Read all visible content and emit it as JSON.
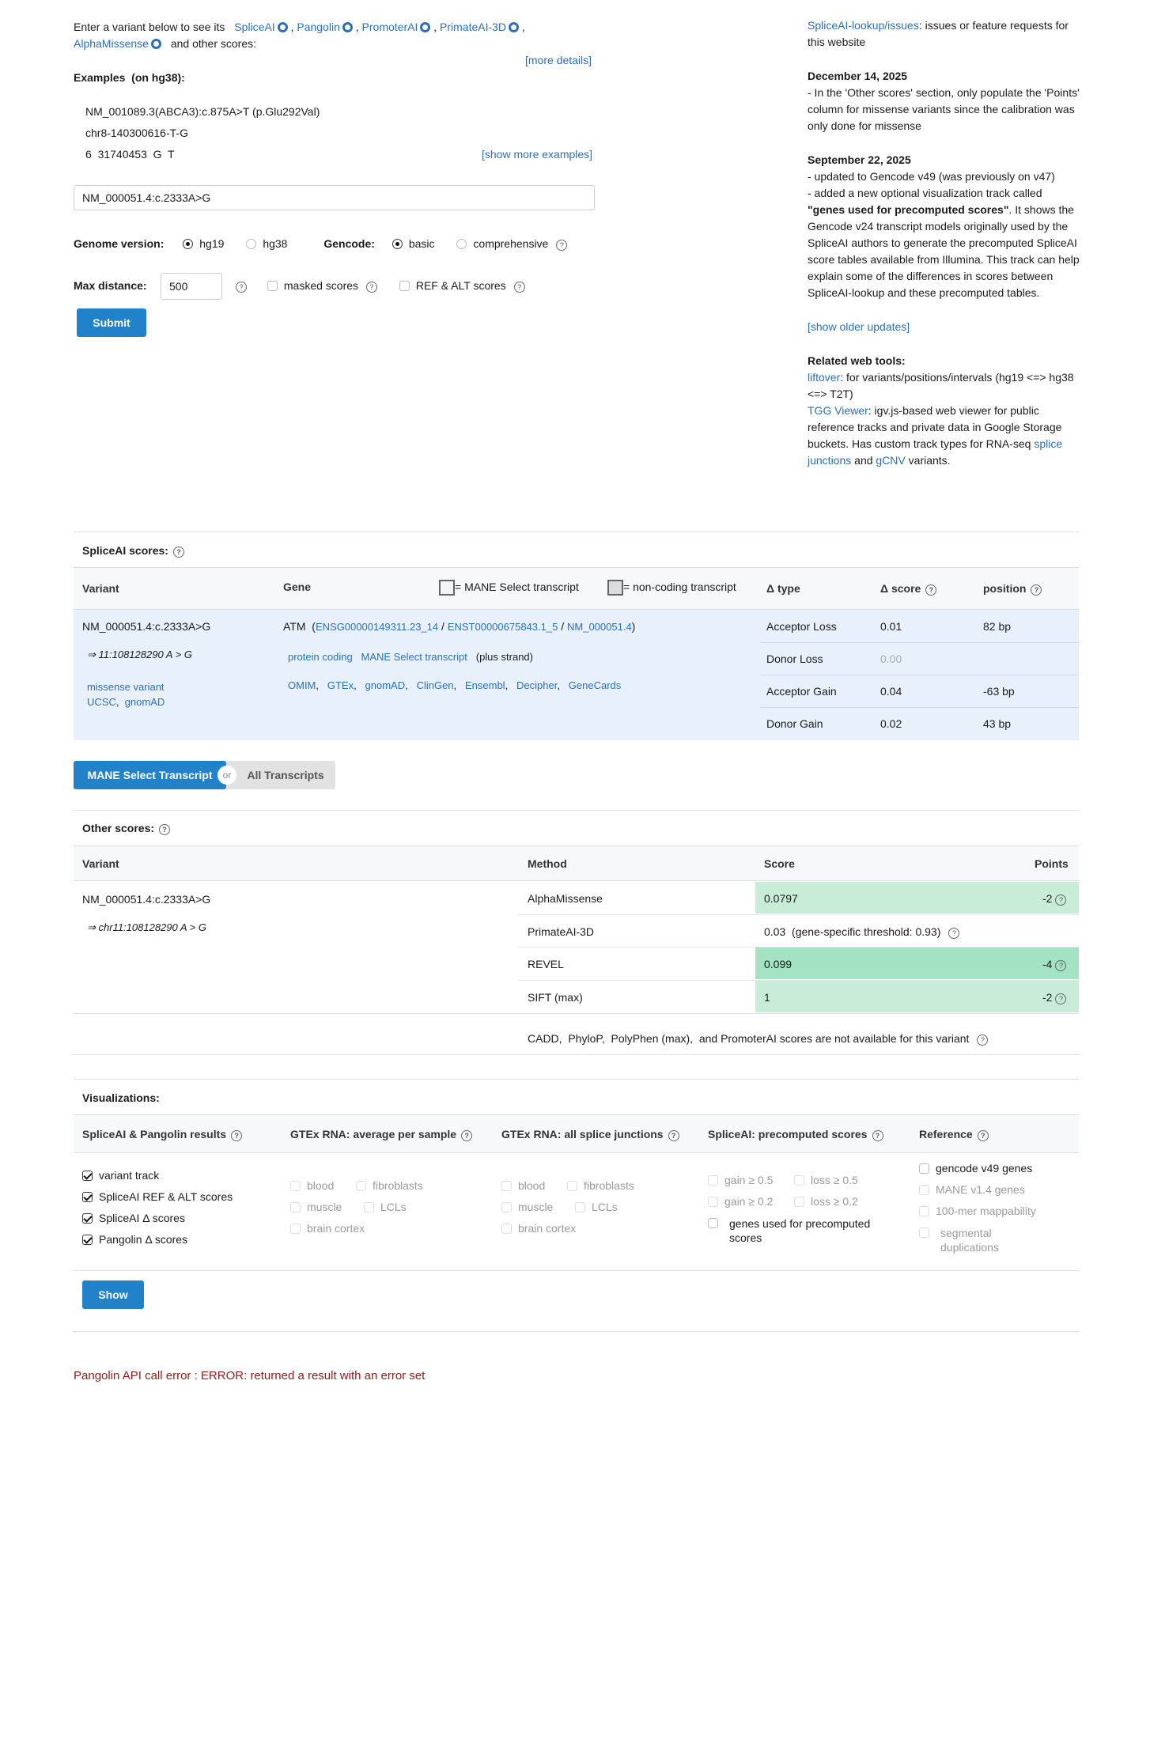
{
  "intro": {
    "text1": "Enter a variant below to see its",
    "tools": [
      "SpliceAI",
      "Pangolin",
      "PromoterAI",
      "PrimateAI-3D",
      "AlphaMissense"
    ],
    "text2": "and other scores:",
    "more_details": "[more details]"
  },
  "examples": {
    "heading": "Examples",
    "build": "(on hg38):",
    "items": [
      "NM_001089.3(ABCA3):c.875A>T (p.Glu292Val)",
      "chr8-140300616-T-G",
      "6  31740453  G  T"
    ],
    "show_more": "[show more examples]"
  },
  "variant_input": {
    "value": "NM_000051.4:c.2333A>G"
  },
  "genome": {
    "label": "Genome version:",
    "options": [
      "hg19",
      "hg38"
    ],
    "selected": "hg19"
  },
  "gencode": {
    "label": "Gencode:",
    "options": [
      "basic",
      "comprehensive"
    ],
    "selected": "basic"
  },
  "max_distance": {
    "label": "Max distance:",
    "value": "500"
  },
  "masked_scores": "masked scores",
  "ref_alt_scores": "REF & ALT scores",
  "submit": "Submit",
  "news": {
    "issues_link": "SpliceAI-lookup/issues",
    "issues_text": ": issues or feature requests for this website",
    "u1_date": "December 14, 2025",
    "u1_text": "- In the 'Other scores' section, only populate the 'Points' column for missense variants since the calibration was only done for missense",
    "u2_date": "September 22, 2025",
    "u2_line1": "- updated to Gencode v49 (was previously on v47)",
    "u2_line2a": "- added a new optional visualization track called ",
    "u2_line2b": "\"genes used for precomputed scores\"",
    "u2_line2c": ". It shows the Gencode v24 transcript models originally used by the SpliceAI authors to generate the precomputed SpliceAI score tables available from Illumina. This track can help explain some of the differences in scores between SpliceAI-lookup and these precomputed tables.",
    "older": "[show older updates]",
    "related_heading": "Related web tools:",
    "liftover": "liftover",
    "liftover_text": ": for variants/positions/intervals (hg19 <=> hg38 <=> T2T)",
    "tgg": "TGG Viewer",
    "tgg_text": ": igv.js-based web viewer for public reference tracks and private data in Google Storage buckets. Has custom track types for RNA-seq ",
    "splice_junctions": "splice junctions",
    "and": " and ",
    "gcnv": "gCNV",
    "variants": " variants."
  },
  "spliceai": {
    "title": "SpliceAI scores:",
    "col_variant": "Variant",
    "col_gene": "Gene",
    "legend_mane": "= MANE Select transcript",
    "legend_noncoding": "= non-coding transcript",
    "col_type": "Δ type",
    "col_score": "Δ score",
    "col_position": "position",
    "variant": "NM_000051.4:c.2333A>G",
    "variant_coord": "⇒ 11:108128290 A > G",
    "consequence": "missense variant",
    "ucsc": "UCSC",
    "gnomad": "gnomAD",
    "gene": "ATM",
    "gene_id": "ENSG00000149311.23_14",
    "transcript_id": "ENST00000675843.1_5",
    "refseq_id": "NM_000051.4",
    "biotype": "protein coding",
    "mane": "MANE Select transcript",
    "strand": "(plus strand)",
    "gene_links": [
      "OMIM",
      "GTEx",
      "gnomAD",
      "ClinGen",
      "Ensembl",
      "Decipher",
      "GeneCards"
    ],
    "rows": [
      {
        "type": "Acceptor Loss",
        "score": "0.01",
        "position": "82 bp"
      },
      {
        "type": "Donor Loss",
        "score": "0.00",
        "position": ""
      },
      {
        "type": "Acceptor Gain",
        "score": "0.04",
        "position": "-63 bp"
      },
      {
        "type": "Donor Gain",
        "score": "0.02",
        "position": "43 bp"
      }
    ]
  },
  "toggle": {
    "mane": "MANE Select Transcript",
    "or": "or",
    "all": "All Transcripts"
  },
  "other": {
    "title": "Other scores:",
    "col_variant": "Variant",
    "col_method": "Method",
    "col_score": "Score",
    "col_points": "Points",
    "variant": "NM_000051.4:c.2333A>G",
    "variant_coord": "⇒ chr11:108128290 A > G",
    "rows": [
      {
        "method": "AlphaMissense",
        "score": "0.0797",
        "points": "-2",
        "color": "#c9ecd9"
      },
      {
        "method": "PrimateAI-3D",
        "score": "0.03  (gene-specific threshold: 0.93)",
        "points": "",
        "color": ""
      },
      {
        "method": "REVEL",
        "score": "0.099",
        "points": "-4",
        "color": "#a3e2c2"
      },
      {
        "method": "SIFT (max)",
        "score": "1",
        "points": "-2",
        "color": "#c9ecd9"
      }
    ],
    "unavailable": "CADD,  PhyloP,  PolyPhen (max),  and PromoterAI scores are not available for this variant"
  },
  "viz": {
    "title": "Visualizations:",
    "col1": "SpliceAI & Pangolin results",
    "col2": "GTEx RNA: average per sample",
    "col3": "GTEx RNA: all splice junctions",
    "col4": "SpliceAI: precomputed scores",
    "col5": "Reference",
    "c1": [
      "variant track",
      "SpliceAI REF & ALT scores",
      "SpliceAI Δ  scores",
      "Pangolin Δ  scores"
    ],
    "c2": [
      "blood",
      "fibroblasts",
      "muscle",
      "LCLs",
      "brain cortex"
    ],
    "c3": [
      "blood",
      "fibroblasts",
      "muscle",
      "LCLs",
      "brain cortex"
    ],
    "c4": [
      "gain ≥ 0.5",
      "loss ≥ 0.5",
      "gain ≥ 0.2",
      "loss ≥ 0.2",
      "genes used for precomputed scores"
    ],
    "c5": [
      "gencode v49 genes",
      "MANE v1.4 genes",
      "100-mer mappability",
      "segmental duplications"
    ],
    "show": "Show"
  },
  "error": "Pangolin API call error : ERROR: returned a result with an error set",
  "colors": {
    "link": "#2c6fb5",
    "button": "#2181c9",
    "row_bg": "#e8f1fb",
    "error": "#8b1a1a"
  }
}
